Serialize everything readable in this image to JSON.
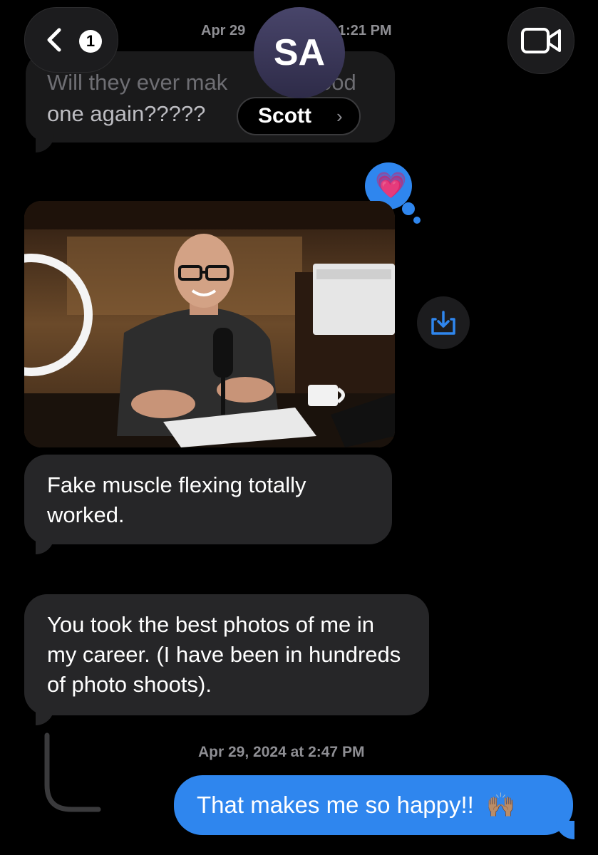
{
  "header": {
    "back_count": "1",
    "timestamp_left": "Apr 29",
    "timestamp_right": "1:21 PM",
    "contact_initials": "SA",
    "video_icon": "video-camera-icon"
  },
  "reply_preview": {
    "text_line1": "Will they ever mak",
    "text_line1_end": "ood",
    "text_line2": "one again?????",
    "sender_name": "Scott"
  },
  "reaction": {
    "emoji": "💗",
    "icon": "pink-heart-reaction"
  },
  "photo": {
    "description_icon": "photo-attachment",
    "save_icon": "download-icon"
  },
  "messages": [
    {
      "id": "m1",
      "direction": "incoming",
      "text": "Fake muscle flexing totally worked."
    },
    {
      "id": "m2",
      "direction": "incoming",
      "text": "You took the best photos of me in my career. (I have been in hundreds of photo shoots)."
    }
  ],
  "timestamp_reply": "Apr 29, 2024 at 2:47 PM",
  "outgoing": {
    "text": "That makes me so happy!!",
    "emoji": "🙌🏽"
  },
  "colors": {
    "background": "#000000",
    "incoming_bubble": "#262628",
    "outgoing_bubble": "#2f86ee",
    "accent": "#2f86ee"
  }
}
